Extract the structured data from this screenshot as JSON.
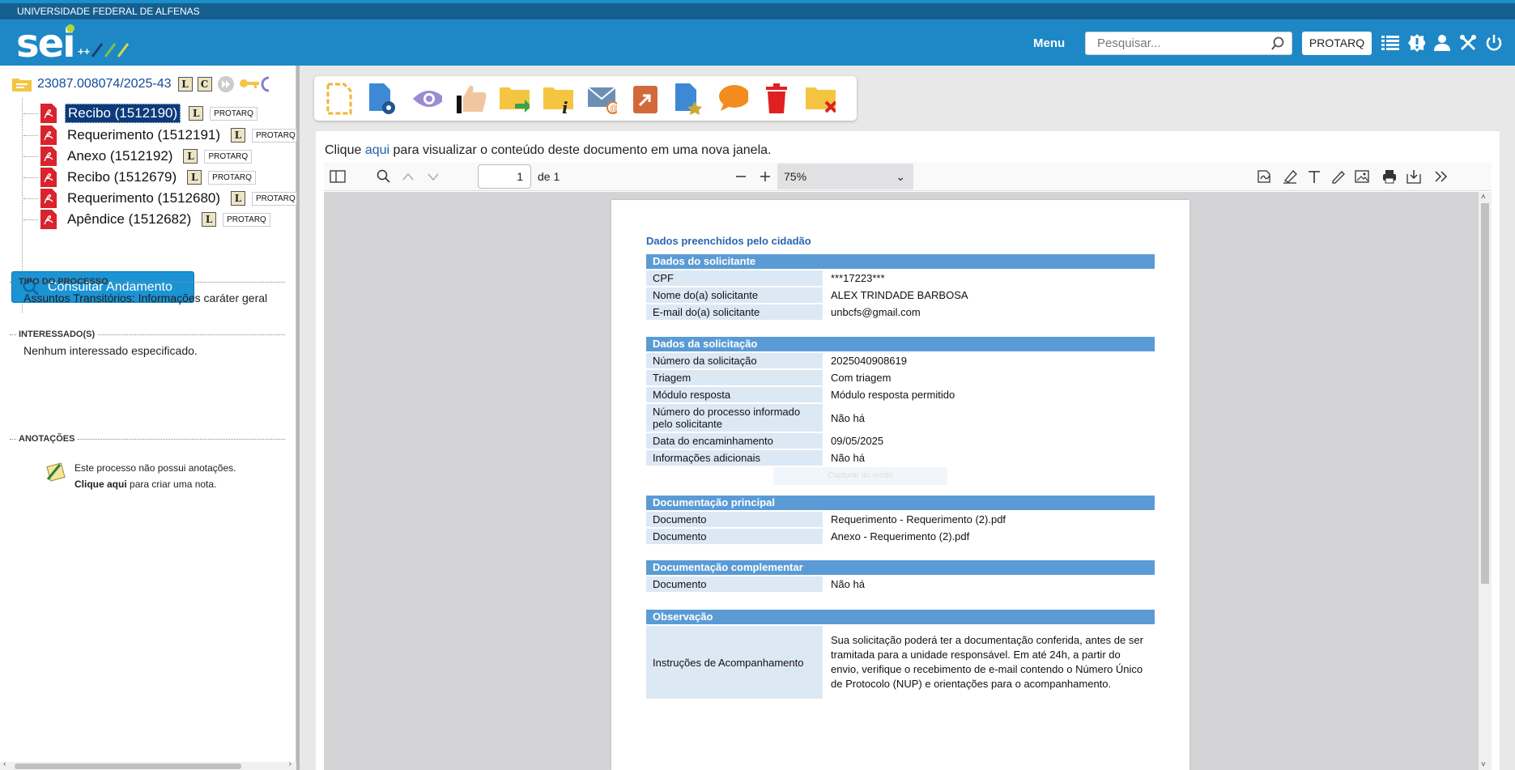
{
  "institution": "UNIVERSIDADE FEDERAL DE ALFENAS",
  "header": {
    "logo_text": "sei",
    "logo_plus": "++",
    "menu_label": "Menu",
    "search_placeholder": "Pesquisar...",
    "unit_label": "PROTARQ",
    "icons": [
      "list-icon",
      "alert-icon",
      "user-icon",
      "tools-icon",
      "power-icon"
    ]
  },
  "tree": {
    "process_number": "23087.008074/2025-43",
    "process_tags": [
      "L",
      "C"
    ],
    "documents": [
      {
        "label": "Recibo (1512190)",
        "tag": "L",
        "unit": "PROTARQ",
        "selected": true
      },
      {
        "label": "Requerimento (1512191)",
        "tag": "L",
        "unit": "PROTARQ",
        "selected": false
      },
      {
        "label": "Anexo (1512192)",
        "tag": "L",
        "unit": "PROTARQ",
        "selected": false
      },
      {
        "label": "Recibo (1512679)",
        "tag": "L",
        "unit": "PROTARQ",
        "selected": false
      },
      {
        "label": "Requerimento (1512680)",
        "tag": "L",
        "unit": "PROTARQ",
        "selected": false
      },
      {
        "label": "Apêndice (1512682)",
        "tag": "L",
        "unit": "PROTARQ",
        "selected": false
      }
    ]
  },
  "consult_button": "Consultar Andamento",
  "sections": {
    "tipo_header": "TIPO DO PROCESSO",
    "tipo_value": "Assuntos Transitórios: Informações caráter geral",
    "interessados_header": "INTERESSADO(S)",
    "interessados_value": "Nenhum interessado especificado.",
    "anotacoes_header": "ANOTAÇÕES",
    "note_pre": "Este processo não possui anotações.",
    "note_link": "Clique aqui",
    "note_post": "para criar uma nota."
  },
  "content": {
    "view_pre": "Clique",
    "view_link": "aqui",
    "view_post": "para visualizar o conteúdo deste documento em uma nova janela."
  },
  "pdf_toolbar": {
    "page_value": "1",
    "page_of": "de 1",
    "zoom": "75%"
  },
  "document": {
    "title": "Dados preenchidos pelo cidadão",
    "faint_overlay": "Capturar do modo",
    "blocks": [
      {
        "header": "Dados do solicitante",
        "rows": [
          {
            "k": "CPF",
            "v": "***17223***"
          },
          {
            "k": "Nome do(a) solicitante",
            "v": "ALEX TRINDADE BARBOSA"
          },
          {
            "k": "E-mail do(a) solicitante",
            "v": "unbcfs@gmail.com"
          }
        ]
      },
      {
        "header": "Dados da solicitação",
        "rows": [
          {
            "k": "Número da solicitação",
            "v": "2025040908619"
          },
          {
            "k": "Triagem",
            "v": "Com triagem"
          },
          {
            "k": "Módulo resposta",
            "v": "Módulo resposta permitido"
          },
          {
            "k": "Número do processo informado pelo solicitante",
            "v": "Não há"
          },
          {
            "k": "Data do encaminhamento",
            "v": "09/05/2025"
          },
          {
            "k": "Informações adicionais",
            "v": "Não há"
          }
        ]
      },
      {
        "header": "Documentação principal",
        "rows": [
          {
            "k": "Documento",
            "v": "Requerimento - Requerimento (2).pdf"
          },
          {
            "k": "Documento",
            "v": "Anexo - Requerimento (2).pdf"
          }
        ]
      },
      {
        "header": "Documentação complementar",
        "rows": [
          {
            "k": "Documento",
            "v": "Não há"
          }
        ]
      },
      {
        "header": "Observação",
        "rows": [
          {
            "k": "Instruções de Acompanhamento",
            "v": "Sua solicitação poderá ter a documentação conferida, antes de ser tramitada para a unidade responsável. Em até 24h, a partir do envio, verifique o recebimento de e-mail contendo o Número Único de Protocolo (NUP) e orientações para o acompanhamento."
          }
        ]
      }
    ]
  },
  "colors": {
    "header_blue": "#1e88c7",
    "institution_bar": "#155f8f",
    "section_blue": "#5b9bd5",
    "key_bg": "#dde8f5",
    "selected_doc": "#0c3a7a"
  }
}
